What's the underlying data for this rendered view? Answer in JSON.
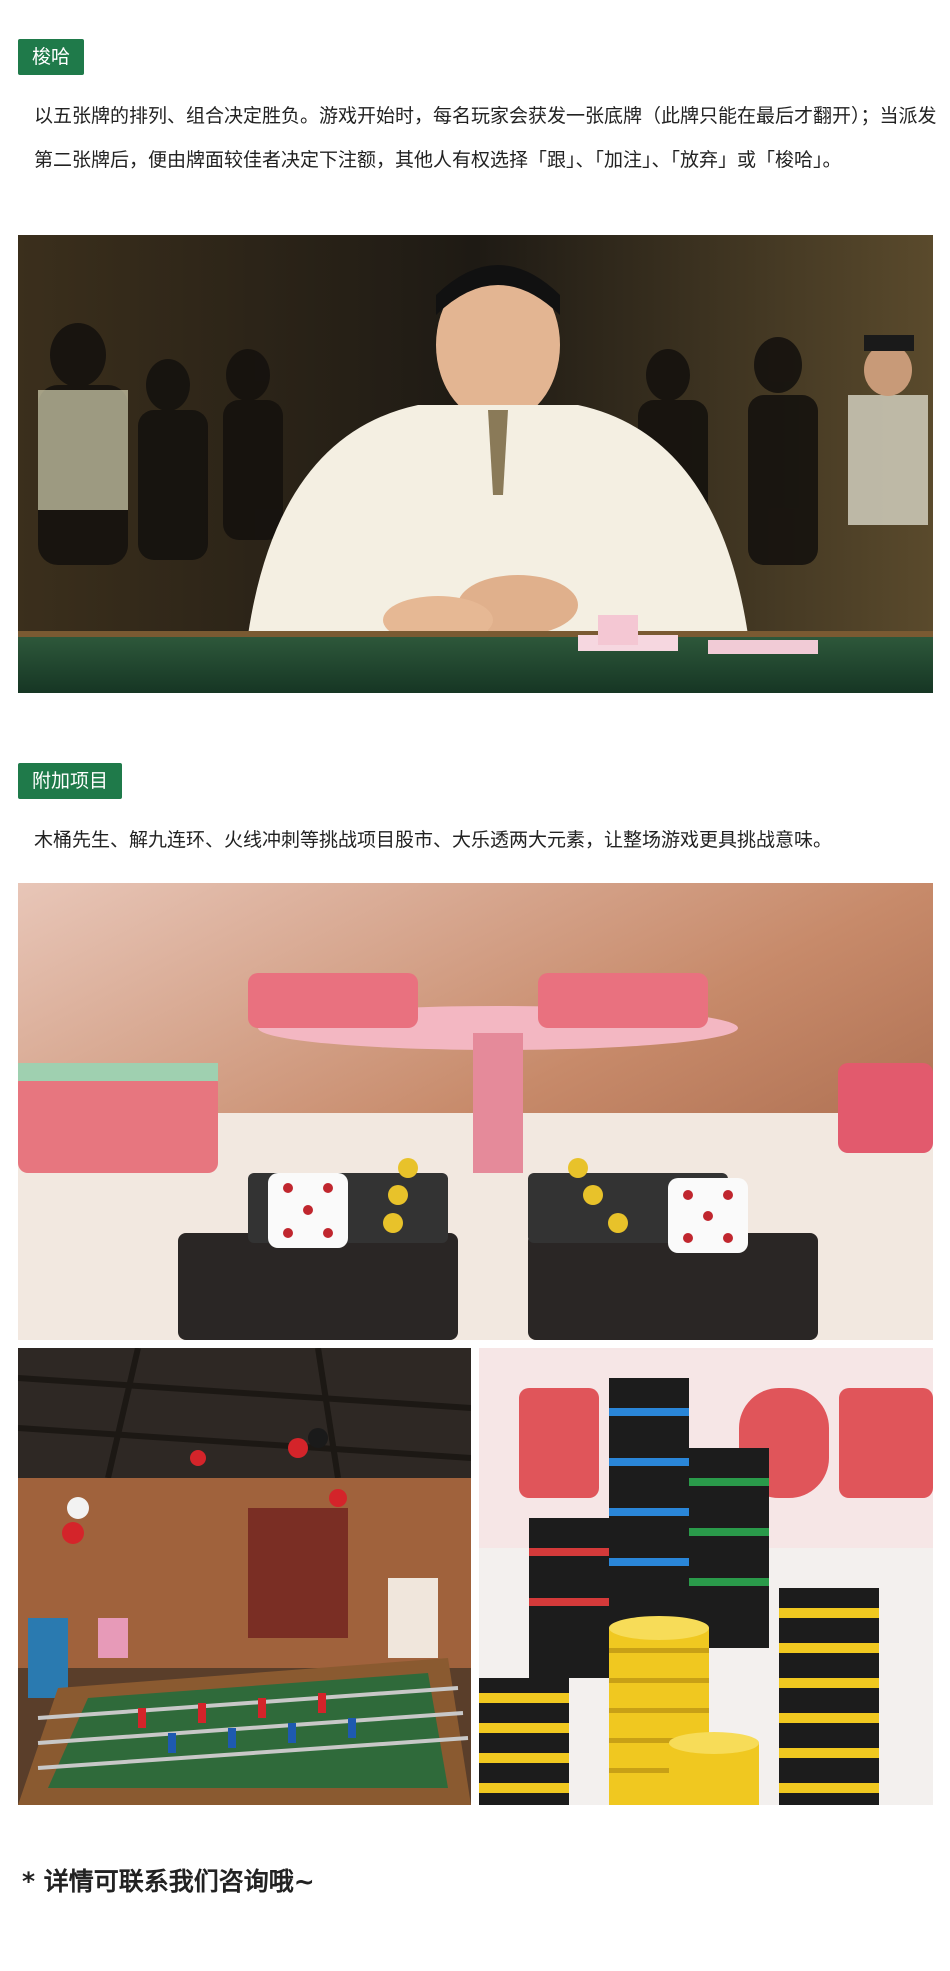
{
  "sections": [
    {
      "tag": "梭哈",
      "text": "以五张牌的排列、组合决定胜负。游戏开始时，每名玩家会获发一张底牌（此牌只能在最后才翻开）；当派发第二张牌后，便由牌面较佳者决定下注额，其他人有权选择「跟」、「加注」、「放弃」或「梭哈」。"
    },
    {
      "tag": "附加项目",
      "text": "木桶先生、解九连环、火线冲刺等挑战项目股市、大乐透两大元素，让整场游戏更具挑战意味。"
    }
  ],
  "footer": "* 详情可联系我们咨询哦~",
  "colors": {
    "tag_bg": "#1f7a4a",
    "tag_text": "#ffffff",
    "body_text": "#222222"
  }
}
